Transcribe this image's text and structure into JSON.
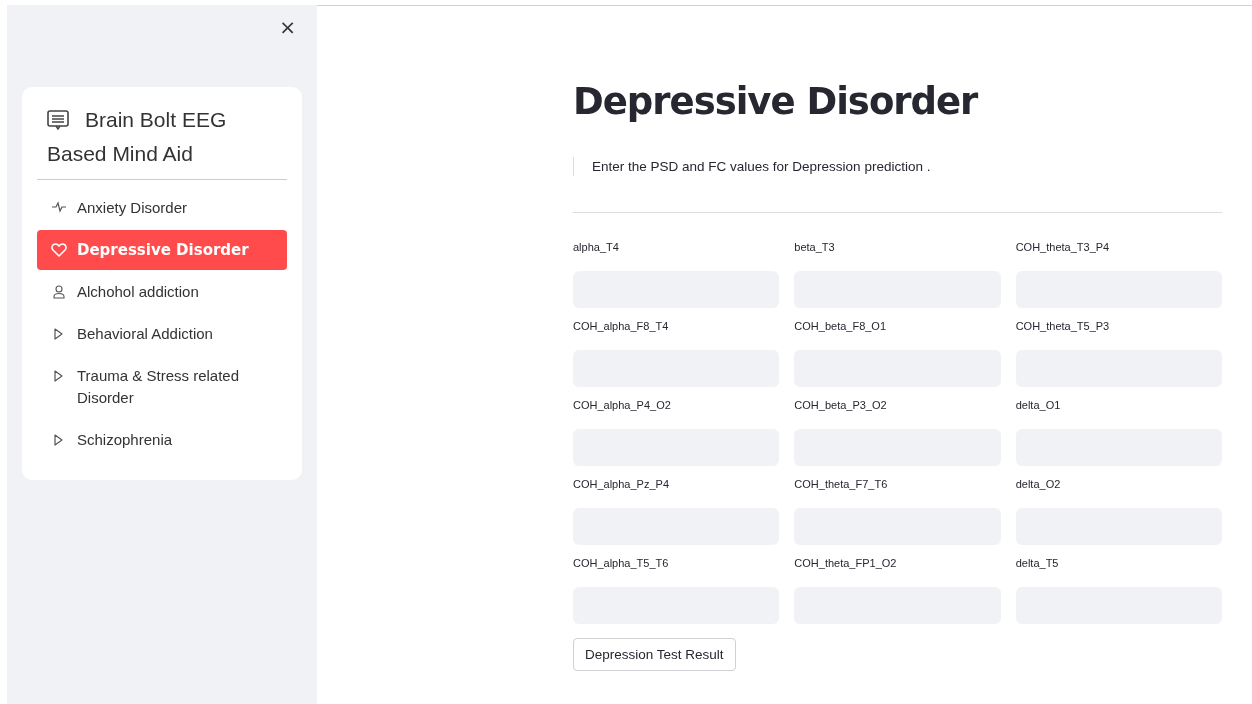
{
  "sidebar": {
    "close": "×",
    "title": "Brain Bolt EEG Based Mind Aid",
    "items": [
      {
        "label": "Anxiety Disorder",
        "kind": "pulse",
        "selected": false
      },
      {
        "label": "Depressive Disorder",
        "kind": "heart",
        "selected": true
      },
      {
        "label": "Alchohol addiction",
        "kind": "person",
        "selected": false
      },
      {
        "label": "Behavioral Addiction",
        "kind": "play",
        "selected": false
      },
      {
        "label": "Trauma & Stress related Disorder",
        "kind": "play",
        "selected": false
      },
      {
        "label": "Schizophrenia",
        "kind": "play",
        "selected": false
      }
    ]
  },
  "main": {
    "title": "Depressive Disorder",
    "note": "Enter the PSD and FC values for Depression prediction .",
    "fields": [
      {
        "label": "alpha_T4"
      },
      {
        "label": "beta_T3"
      },
      {
        "label": "COH_theta_T3_P4"
      },
      {
        "label": "COH_alpha_F8_T4"
      },
      {
        "label": "COH_beta_F8_O1"
      },
      {
        "label": "COH_theta_T5_P3"
      },
      {
        "label": "COH_alpha_P4_O2"
      },
      {
        "label": "COH_beta_P3_O2"
      },
      {
        "label": "delta_O1"
      },
      {
        "label": "COH_alpha_Pz_P4"
      },
      {
        "label": "COH_theta_F7_T6"
      },
      {
        "label": "delta_O2"
      },
      {
        "label": "COH_alpha_T5_T6"
      },
      {
        "label": "COH_theta_FP1_O2"
      },
      {
        "label": "delta_T5"
      }
    ],
    "button": "Depression Test Result"
  }
}
